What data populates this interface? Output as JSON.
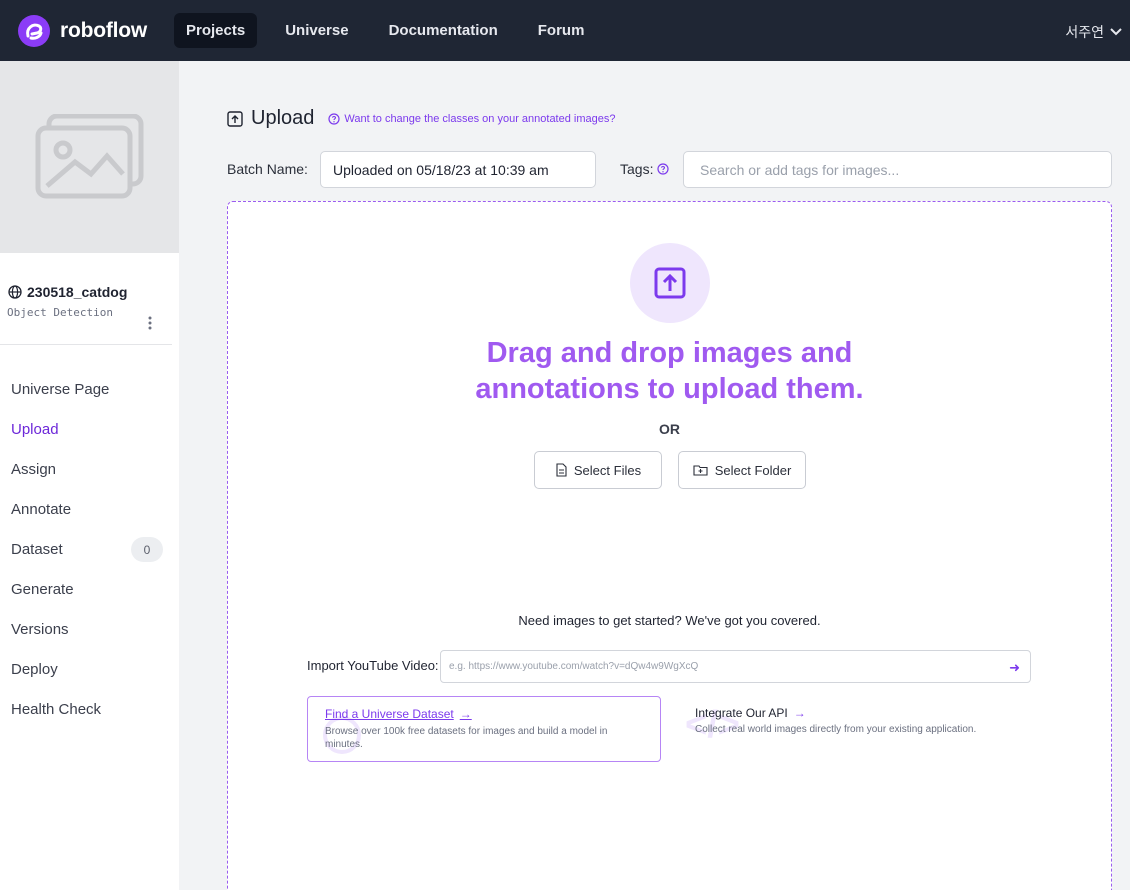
{
  "topbar": {
    "brand": "roboflow",
    "nav": [
      "Projects",
      "Universe",
      "Documentation",
      "Forum"
    ],
    "active_nav": "Projects",
    "user_name": "서주연"
  },
  "sidebar": {
    "project_name": "230518_catdog",
    "project_type": "Object Detection",
    "items": [
      {
        "label": "Universe Page"
      },
      {
        "label": "Upload"
      },
      {
        "label": "Assign"
      },
      {
        "label": "Annotate"
      },
      {
        "label": "Dataset",
        "badge": "0"
      },
      {
        "label": "Generate"
      },
      {
        "label": "Versions"
      },
      {
        "label": "Deploy"
      },
      {
        "label": "Health Check"
      }
    ],
    "active_item": "Upload"
  },
  "main": {
    "title": "Upload",
    "help_link": "Want to change the classes on your annotated images?",
    "batch_label": "Batch Name:",
    "batch_value": "Uploaded on 05/18/23 at 10:39 am",
    "tags_label": "Tags:",
    "tags_placeholder": "Search or add tags for images...",
    "drop_title_line1": "Drag and drop images and",
    "drop_title_line2": "annotations to upload them.",
    "or_text": "OR",
    "select_files": "Select Files",
    "select_folder": "Select Folder",
    "need_images": "Need images to get started? We've got you covered.",
    "youtube_label": "Import YouTube Video:",
    "youtube_placeholder": "e.g. https://www.youtube.com/watch?v=dQw4w9WgXcQ",
    "universe_card_title": "Find a Universe Dataset",
    "universe_card_desc": "Browse over 100k free datasets for images and build a model in minutes.",
    "api_title": "Integrate Our API",
    "api_desc": "Collect real world images directly from your existing application.",
    "accent_color": "#a05af0"
  }
}
